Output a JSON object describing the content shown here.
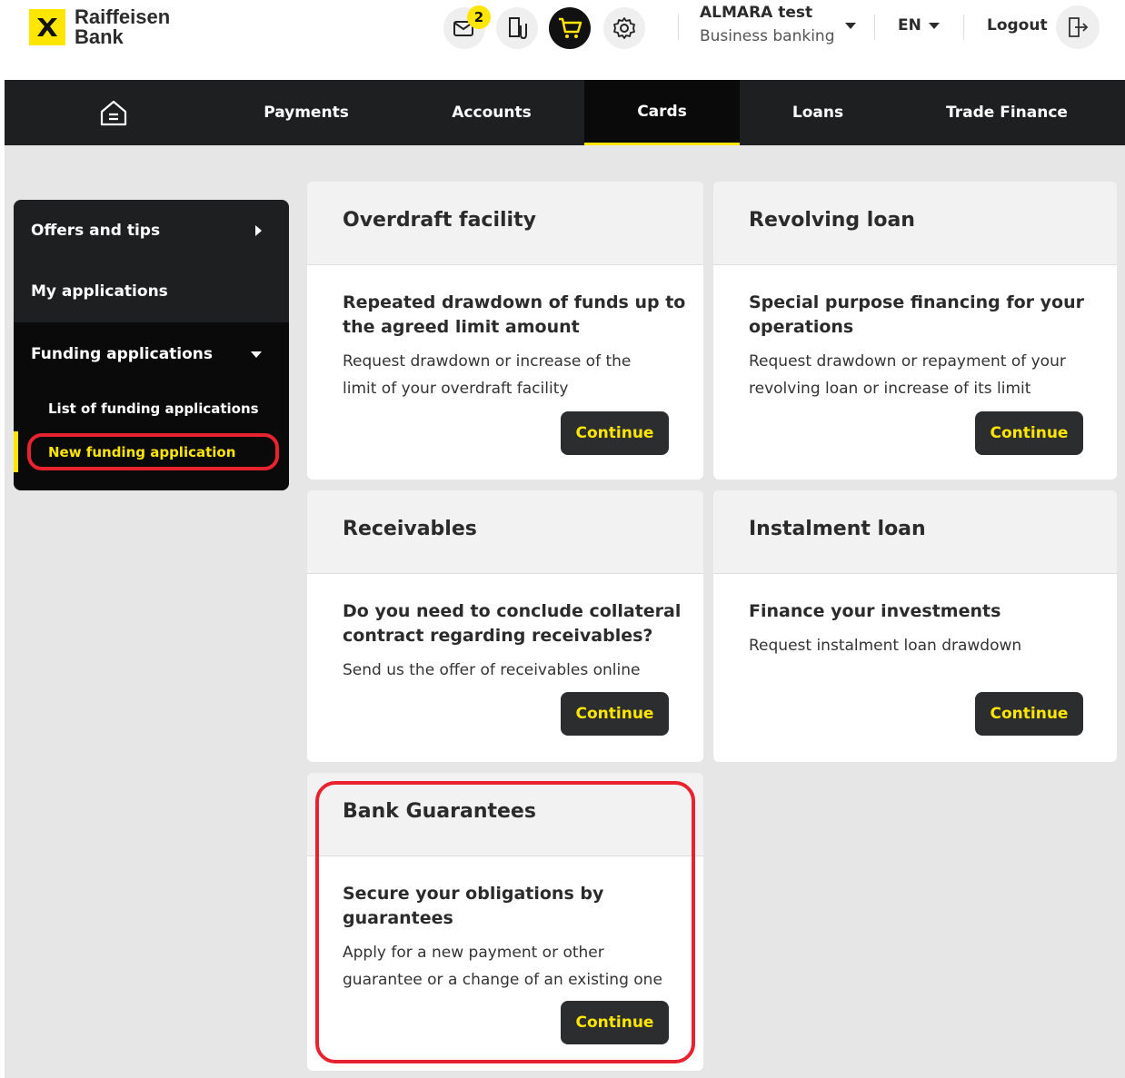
{
  "header": {
    "brand_line1": "Raiffeisen",
    "brand_line2": "Bank",
    "mail_badge": "2",
    "user_name": "ALMARA test",
    "user_subtitle": "Business banking",
    "language": "EN",
    "logout_label": "Logout",
    "icons": [
      "mail-icon",
      "document-attachment-icon",
      "cart-icon",
      "gear-icon",
      "logout-icon"
    ],
    "accent_color": "#fee600"
  },
  "nav": {
    "items": [
      {
        "label": "Payments"
      },
      {
        "label": "Accounts"
      },
      {
        "label": "Cards"
      },
      {
        "label": "Loans"
      },
      {
        "label": "Trade Finance"
      }
    ],
    "active": "Cards"
  },
  "sidebar": {
    "offers": "Offers and tips",
    "my_applications": "My applications",
    "funding_applications": "Funding applications",
    "list_of_funding": "List of funding applications",
    "new_funding": "New funding application"
  },
  "cards": [
    {
      "title": "Overdraft facility",
      "subtitle": "Repeated drawdown of funds up to the agreed limit amount",
      "description": "Request drawdown or increase of the limit of your overdraft facility",
      "button": "Continue"
    },
    {
      "title": "Revolving loan",
      "subtitle": "Special purpose financing for your operations",
      "description": "Request drawdown or repayment of your revolving loan or increase of its limit",
      "button": "Continue"
    },
    {
      "title": "Receivables",
      "subtitle": "Do you need to conclude collateral contract regarding receivables?",
      "description": "Send us the offer of receivables online",
      "button": "Continue"
    },
    {
      "title": "Instalment loan",
      "subtitle": "Finance your investments",
      "description": "Request instalment loan drawdown",
      "button": "Continue"
    },
    {
      "title": "Bank Guarantees",
      "subtitle": "Secure your obligations by guarantees",
      "description": "Apply for a new payment or other guarantee or a change of an existing one",
      "button": "Continue"
    }
  ]
}
